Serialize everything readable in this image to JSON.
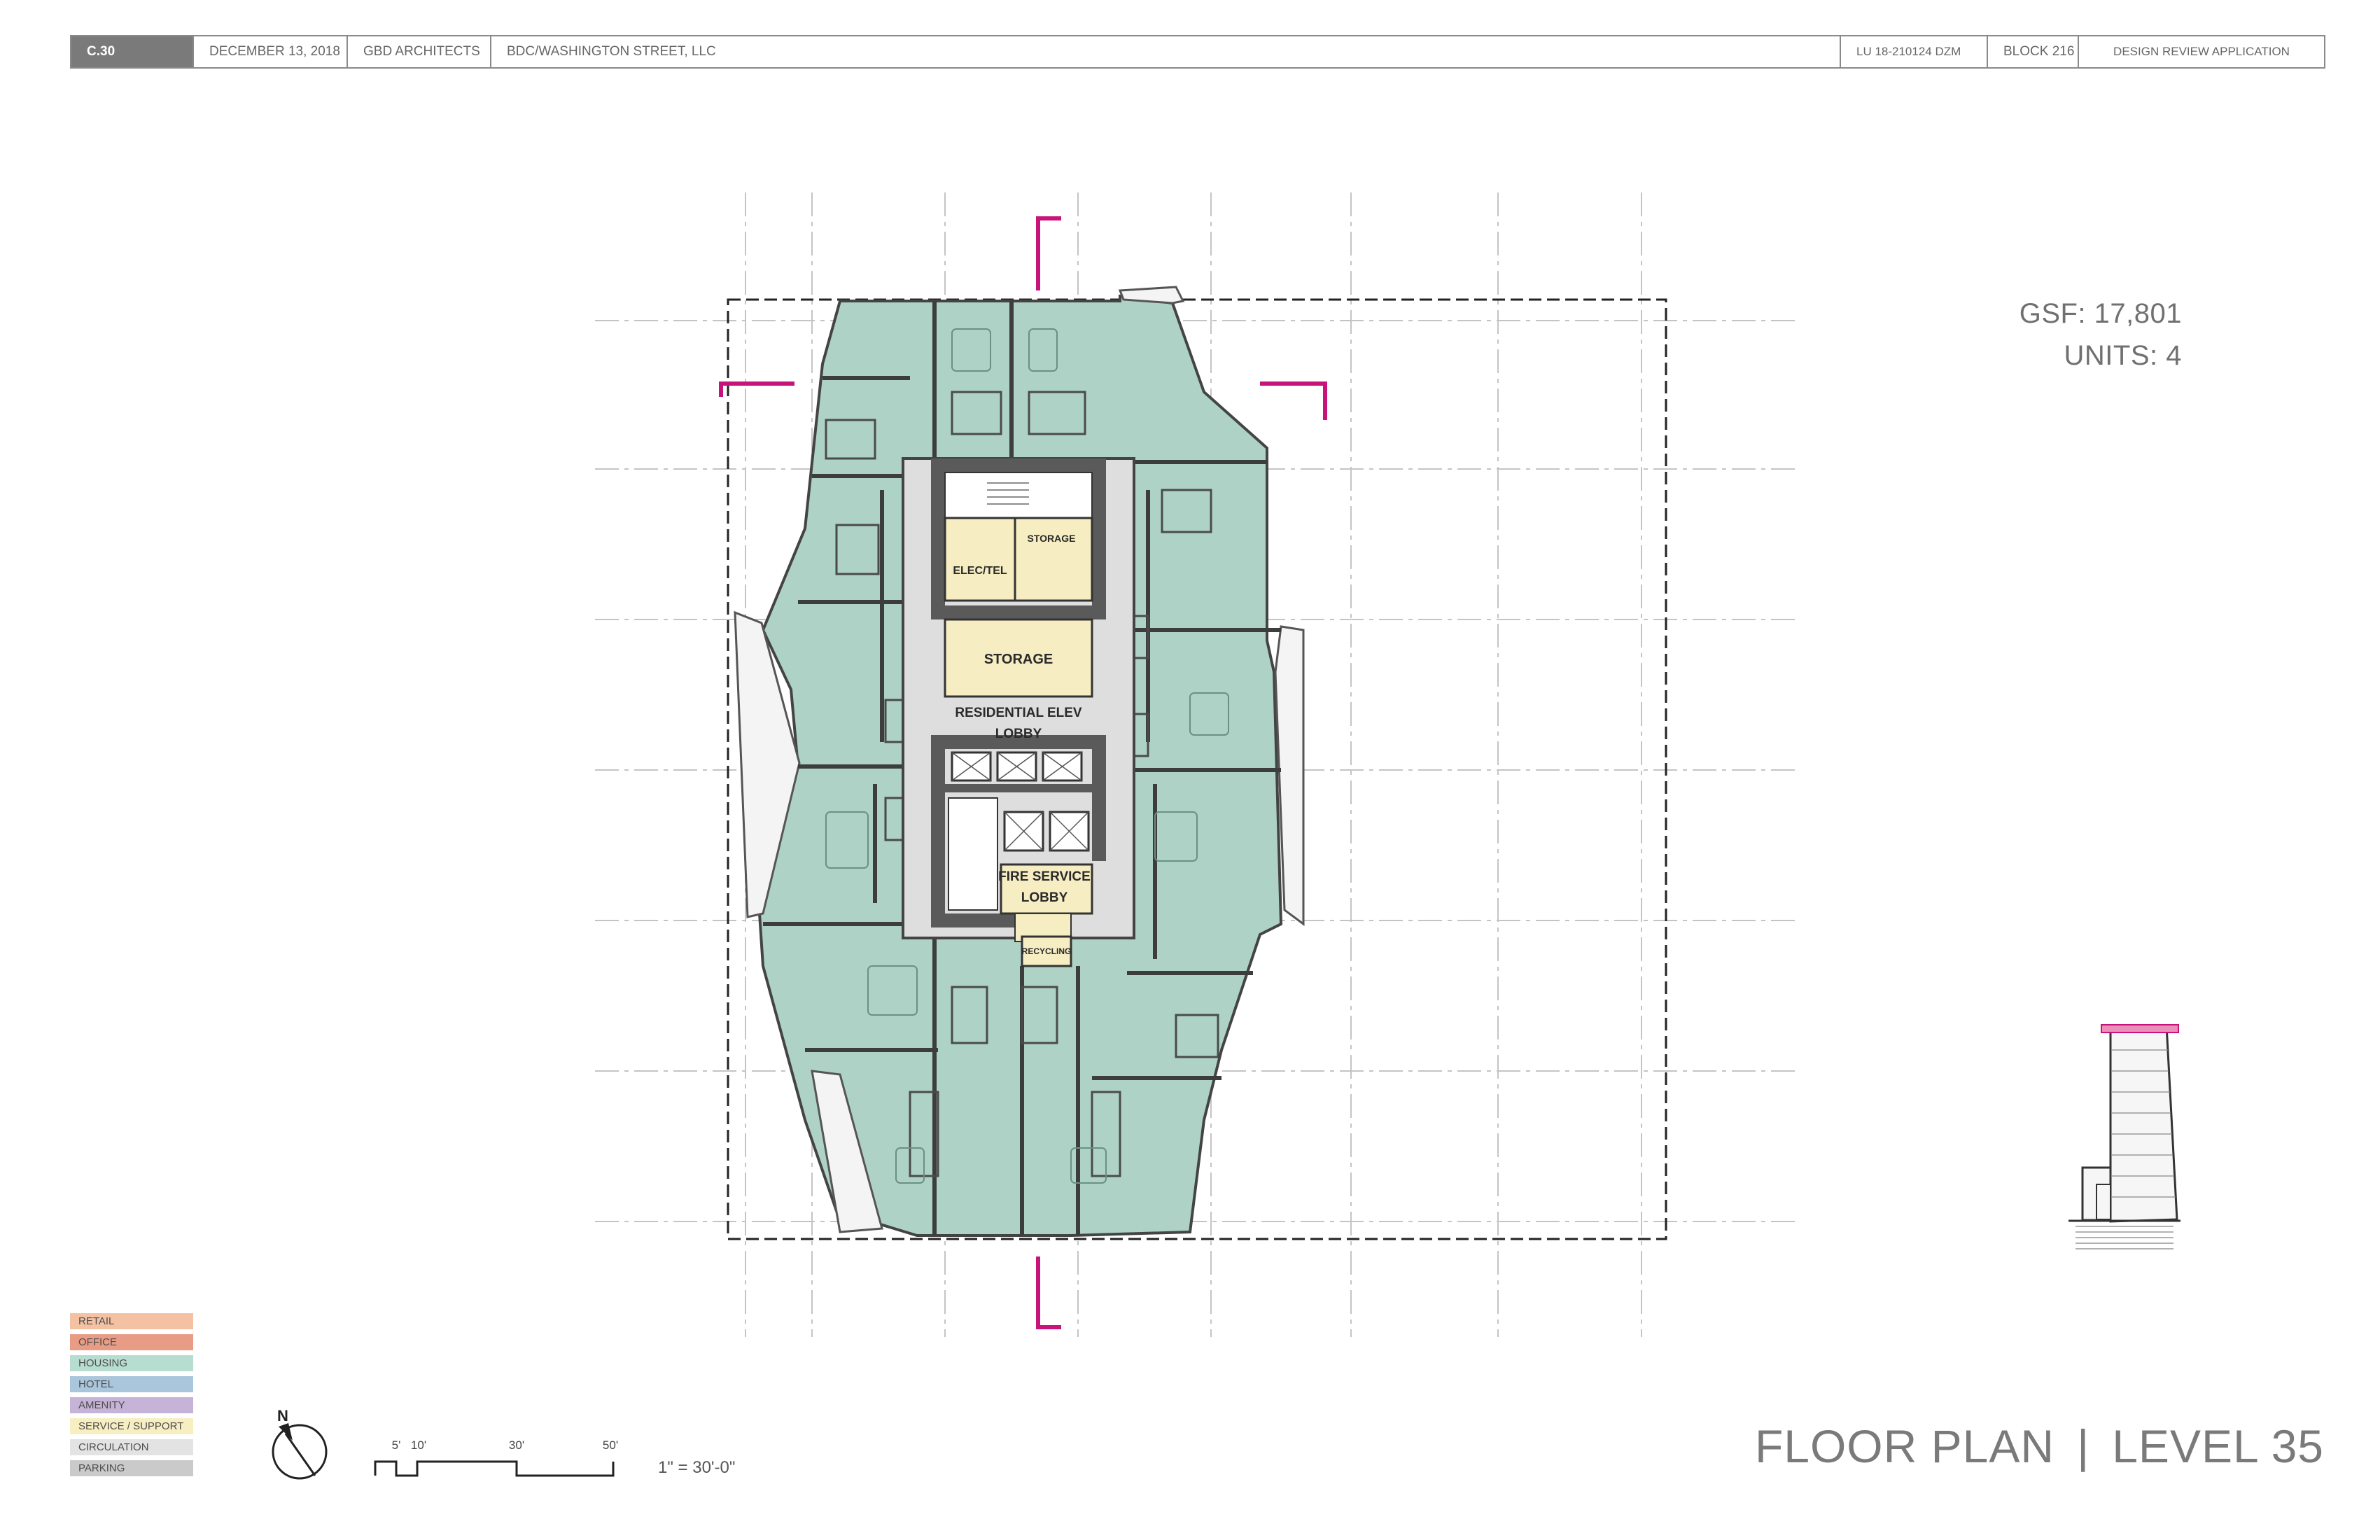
{
  "title_block": {
    "sheet_number": "C.30",
    "date": "DECEMBER 13,  2018",
    "architect": "GBD ARCHITECTS",
    "client": "BDC/WASHINGTON STREET, LLC",
    "case_number": "LU 18-210124 DZM",
    "block": "BLOCK 216",
    "application": "DESIGN REVIEW APPLICATION"
  },
  "stats": {
    "gsf": "GSF:  17,801",
    "units": "UNITS:  4"
  },
  "sheet_title": {
    "left": "FLOOR PLAN",
    "separator": "|",
    "right": "LEVEL 35"
  },
  "rooms": {
    "storage_small": "STORAGE",
    "elec_tel": "ELEC/TEL",
    "storage_main": "STORAGE",
    "res_lobby_line1": "RESIDENTIAL ELEV",
    "res_lobby_line2": "LOBBY",
    "fire_line1": "FIRE SERVICE",
    "fire_line2": "LOBBY",
    "recycling": "RECYCLING"
  },
  "legend": [
    {
      "label": "RETAIL",
      "color": "#f4c2a3"
    },
    {
      "label": "OFFICE",
      "color": "#e89c86"
    },
    {
      "label": "HOUSING",
      "color": "#b7dcd0"
    },
    {
      "label": "HOTEL",
      "color": "#a9c6dc"
    },
    {
      "label": "AMENITY",
      "color": "#c6b3d8"
    },
    {
      "label": "SERVICE / SUPPORT",
      "color": "#f7efc2"
    },
    {
      "label": "CIRCULATION",
      "color": "#e3e3e3"
    },
    {
      "label": "PARKING",
      "color": "#cacaca"
    }
  ],
  "scale": {
    "ticks": [
      "5'",
      "10'",
      "30'",
      "50'"
    ],
    "label": "1\" = 30'-0\""
  },
  "north_label": "N",
  "colors": {
    "housing": "#aed3c6",
    "service": "#f6edc2",
    "circulation": "#dedede",
    "core_wall": "#5a5a5a",
    "section_marker": "#c8137a"
  }
}
